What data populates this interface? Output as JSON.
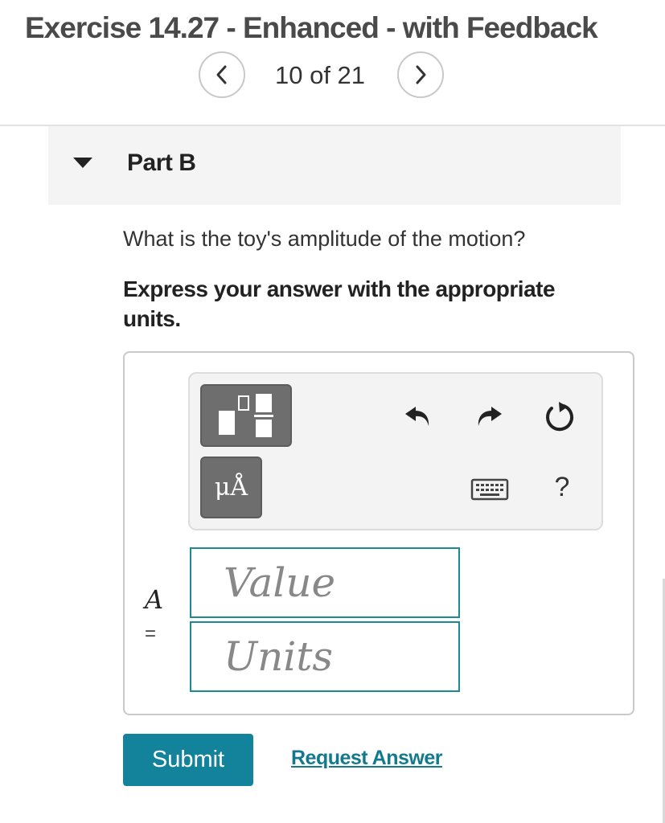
{
  "header": {
    "title": "Exercise 14.27 - Enhanced - with Feedback",
    "pager": {
      "position_text": "10 of 21",
      "prev_icon": "chevron-left-icon",
      "next_icon": "chevron-right-icon"
    }
  },
  "part": {
    "title": "Part B",
    "expanded_icon": "caret-down-icon"
  },
  "question": {
    "text": "What is the toy's amplitude of the motion?",
    "instruction": "Express your answer with the appropriate units."
  },
  "answer": {
    "toolbar": {
      "templates_icon": "templates-icon",
      "units_label": "μÅ",
      "undo_icon": "undo-icon",
      "redo_icon": "redo-icon",
      "reset_icon": "reset-icon",
      "keyboard_icon": "keyboard-icon",
      "help_label": "?"
    },
    "variable": "A",
    "equals": "=",
    "value_placeholder": "Value",
    "units_placeholder": "Units"
  },
  "actions": {
    "submit_label": "Submit",
    "request_answer_label": "Request Answer"
  },
  "colors": {
    "accent": "#12839a",
    "link": "#137a8e",
    "input_border": "#1c8a95"
  }
}
